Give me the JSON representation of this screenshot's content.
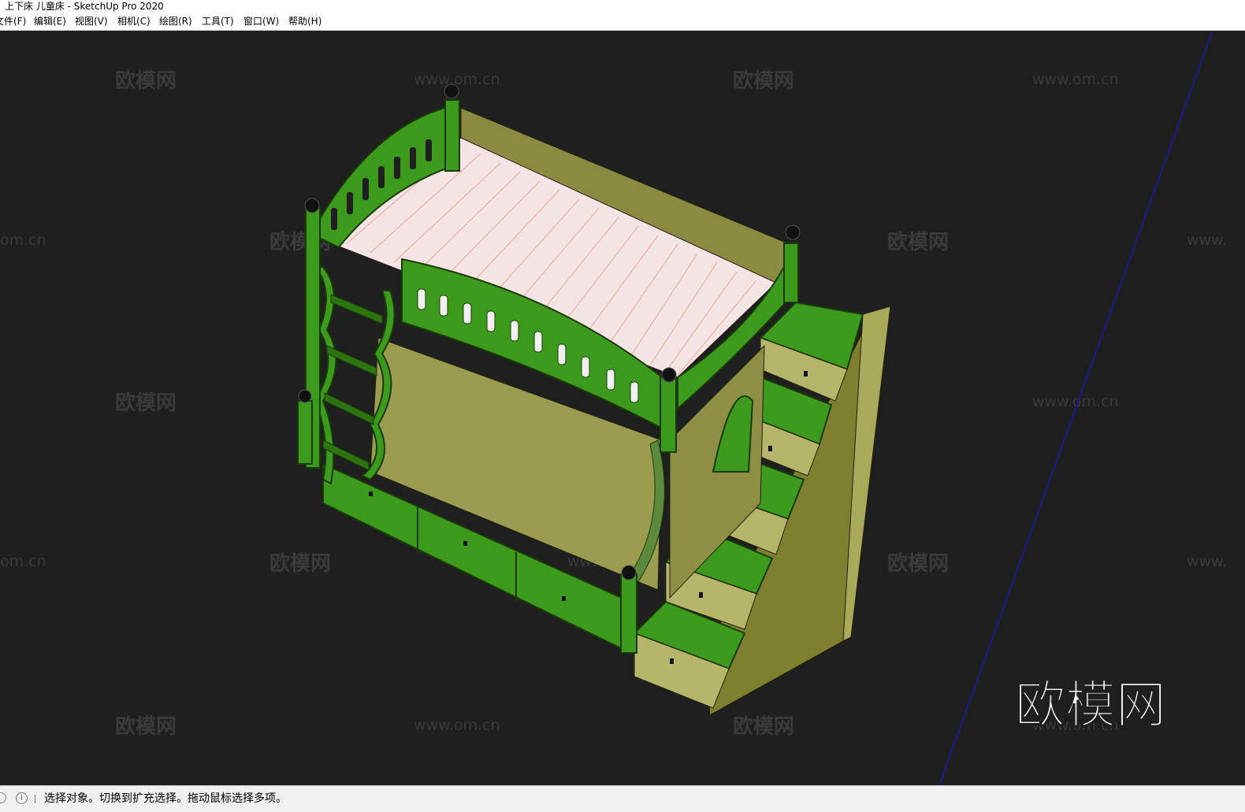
{
  "window": {
    "title": "上下床 儿童床 - SketchUp Pro 2020"
  },
  "menu": [
    {
      "label": "文件(F)"
    },
    {
      "label": "编辑(E)"
    },
    {
      "label": "视图(V)"
    },
    {
      "label": "相机(C)"
    },
    {
      "label": "绘图(R)"
    },
    {
      "label": "工具(T)"
    },
    {
      "label": "窗口(W)"
    },
    {
      "label": "帮助(H)"
    }
  ],
  "watermarks": {
    "brand": "欧模网",
    "url": "www.om.cn",
    "url_partial_left": "om.cn",
    "url_partial_right": "www."
  },
  "corner_logo": "欧模网",
  "status": {
    "message": "选择对象。切换到扩充选择。拖动鼠标选择多项。",
    "info_icon": "info-icon",
    "help_icon": "help-icon"
  },
  "colors": {
    "viewport": "#1f1f1f",
    "green": "#3c9a1c",
    "green_dark": "#2c7410",
    "panel": "#9a9a45",
    "mattress": "#f4e4e4",
    "axis": "#1a1a88"
  }
}
